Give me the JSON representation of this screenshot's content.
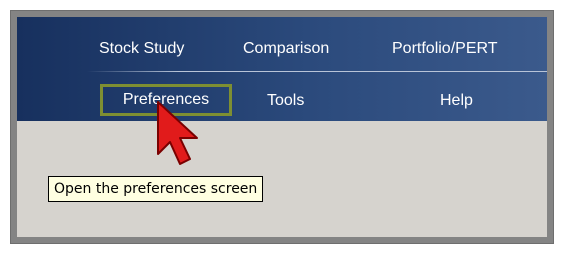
{
  "menu": {
    "row1": [
      "Stock Study",
      "Comparison",
      "Portfolio/PERT"
    ],
    "row2": [
      "Preferences",
      "Tools",
      "Help"
    ]
  },
  "tooltip": "Open the preferences screen",
  "icons": {
    "pointer": "red-arrow-cursor-icon"
  },
  "colors": {
    "nav_dark": "#17305e",
    "nav_light": "#3b5a8c",
    "highlight_border": "#7e8f32",
    "panel_bg": "#d6d3ce",
    "tooltip_bg": "#ffffe1",
    "arrow": "#e11b1b"
  }
}
